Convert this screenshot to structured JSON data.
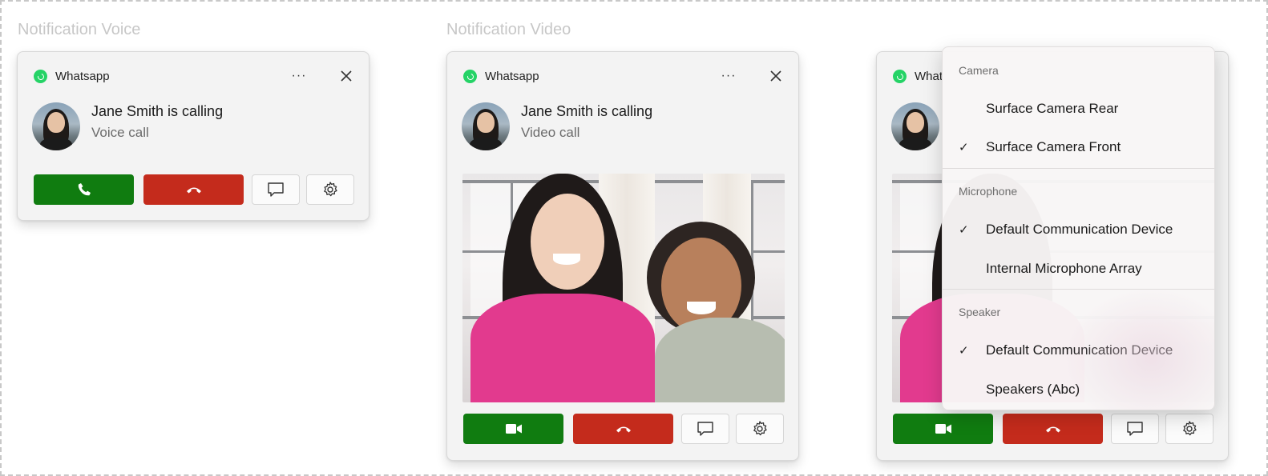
{
  "sections": {
    "voice_label": "Notification Voice",
    "video_label": "Notification Video"
  },
  "voice_card": {
    "app_name": "Whatsapp",
    "more_label": "···",
    "caller": "Jane Smith is calling",
    "call_type": "Voice call"
  },
  "video_card": {
    "app_name": "Whatsapp",
    "more_label": "···",
    "caller": "Jane Smith is calling",
    "call_type": "Video call"
  },
  "third_card": {
    "app_name_partial": "What"
  },
  "device_menu": {
    "camera_header": "Camera",
    "camera_items": [
      {
        "label": "Surface Camera Rear",
        "check": ""
      },
      {
        "label": "Surface Camera Front",
        "check": "✓"
      }
    ],
    "microphone_header": "Microphone",
    "microphone_items": [
      {
        "label": "Default Communication Device",
        "check": "✓"
      },
      {
        "label": "Internal Microphone Array",
        "check": ""
      }
    ],
    "speaker_header": "Speaker",
    "speaker_items": [
      {
        "label": "Default Communication Device",
        "check": "✓"
      },
      {
        "label": "Speakers (Abc)",
        "check": ""
      }
    ]
  },
  "icons": {
    "app": "whatsapp-icon",
    "more": "more-icon",
    "close": "close-icon",
    "accept_voice": "phone-icon",
    "accept_video": "video-camera-icon",
    "decline": "hang-up-icon",
    "message": "chat-bubble-icon",
    "settings": "gear-icon"
  },
  "colors": {
    "accept": "#107c10",
    "decline": "#c42b1c",
    "whatsapp": "#25d366"
  }
}
